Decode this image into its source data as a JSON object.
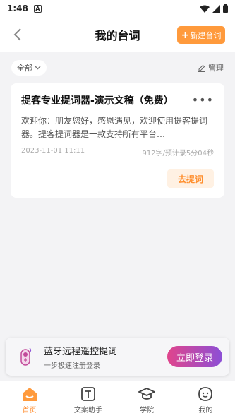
{
  "status_bar": {
    "time": "1:48",
    "notification_letter": "A"
  },
  "header": {
    "title": "我的台词",
    "new_button_label": "新建台词"
  },
  "filter": {
    "selected": "全部",
    "manage_label": "管理"
  },
  "script_card": {
    "title": "提客专业提词器-演示文稿（免费）",
    "preview": "欢迎你：朋友您好，感恩遇见，欢迎使用提客提词器。提客提词器是一款支持所有平台…",
    "date": "2023-11-01 11:11",
    "stats": "912字/预计录5分04秒",
    "more_label": "•••",
    "prompt_button_label": "去提词"
  },
  "bluetooth_banner": {
    "title": "蓝牙远程遥控提词",
    "subtitle": "一步极速注册登录",
    "login_button_label": "立即登录"
  },
  "bottom_nav": {
    "items": [
      {
        "label": "首页",
        "icon": "home-icon",
        "active": true
      },
      {
        "label": "文案助手",
        "icon": "text-assistant-icon",
        "active": false
      },
      {
        "label": "学院",
        "icon": "graduation-cap-icon",
        "active": false
      },
      {
        "label": "我的",
        "icon": "profile-icon",
        "active": false
      }
    ]
  },
  "colors": {
    "accent": "#ff9a3c",
    "active_nav": "#ff8a2a",
    "login_gradient_start": "#e0458c",
    "login_gradient_end": "#8c4fd6"
  }
}
